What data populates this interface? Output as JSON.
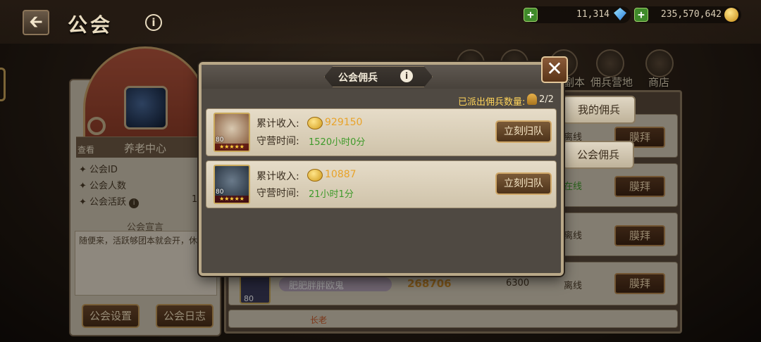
{
  "header": {
    "title": "公会",
    "back_icon": "back-arrow-icon",
    "info_icon": "info-icon",
    "diamonds": "11,314",
    "gold": "235,570,642"
  },
  "right_tabs": [
    {
      "label": "副本",
      "icon": "dungeon-icon"
    },
    {
      "label": "佣兵营地",
      "icon": "helmet-icon"
    },
    {
      "label": "商店",
      "icon": "scale-icon"
    }
  ],
  "guild": {
    "view_label": "查看",
    "name": "养老中心",
    "stats": [
      "公会ID",
      "公会人数",
      "公会活跃"
    ],
    "stat_partial_value": "1",
    "motto_title": "公会宣言",
    "motto": "随便来，活跃够团本就会开，休闲院",
    "settings_button": "公会设置",
    "log_button": "公会日志"
  },
  "member_list": {
    "rows": [
      {
        "status": "离线",
        "action": "膜拜"
      },
      {
        "status": "在线",
        "action": "膜拜"
      },
      {
        "status": "离线",
        "action": "膜拜"
      },
      {
        "level": "80",
        "name": "肥肥胖胖欧鬼",
        "power": "268706",
        "contribution": "6300",
        "status": "离线",
        "action": "膜拜"
      },
      {
        "rank": "长老"
      }
    ]
  },
  "side_tabs": {
    "my_mercenary": "我的佣兵",
    "guild_mercenary": "公会佣兵"
  },
  "modal": {
    "title": "公会佣兵",
    "dispatched_label": "已派出佣兵数量:",
    "dispatched_count": "2/2",
    "close_icon": "close-icon",
    "income_label": "累计收入:",
    "time_label": "守营时间:",
    "mercenaries": [
      {
        "level": "80",
        "stars": "★★★★★",
        "income": "929150",
        "time": "1520小时0分",
        "button": "立刻归队",
        "portrait_color": "#7a4a2a"
      },
      {
        "level": "80",
        "stars": "★★★★★",
        "income": "10887",
        "time": "21小时1分",
        "button": "立刻归队",
        "portrait_color": "#2a3a4a"
      }
    ]
  }
}
